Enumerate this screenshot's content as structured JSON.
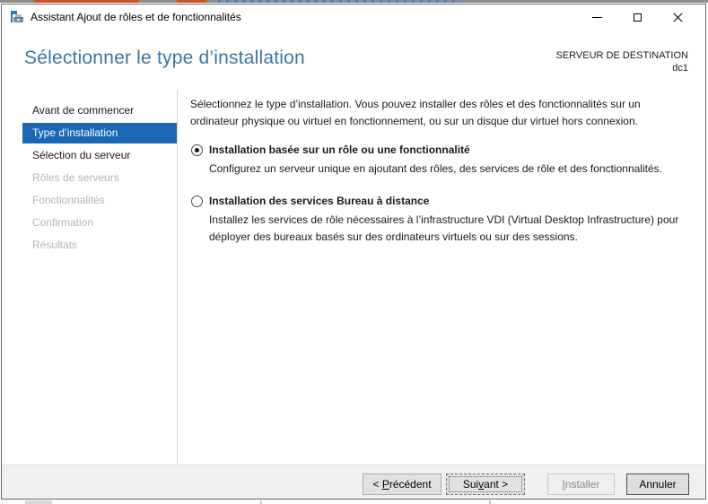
{
  "window": {
    "title": "Assistant Ajout de rôles et de fonctionnalités"
  },
  "header": {
    "page_title": "Sélectionner le type d’installation",
    "destination_label": "SERVEUR DE DESTINATION",
    "destination_server": "dc1"
  },
  "sidebar": {
    "items": [
      {
        "label": "Avant de commencer",
        "state": "enabled"
      },
      {
        "label": "Type d’installation",
        "state": "selected"
      },
      {
        "label": "Sélection du serveur",
        "state": "enabled"
      },
      {
        "label": "Rôles de serveurs",
        "state": "disabled"
      },
      {
        "label": "Fonctionnalités",
        "state": "disabled"
      },
      {
        "label": "Confirmation",
        "state": "disabled"
      },
      {
        "label": "Résultats",
        "state": "disabled"
      }
    ]
  },
  "content": {
    "intro": "Sélectionnez le type d’installation. Vous pouvez installer des rôles et des fonctionnalités sur un ordinateur physique ou virtuel en fonctionnement, ou sur un disque dur virtuel hors connexion.",
    "options": [
      {
        "selected": true,
        "label": "Installation basée sur un rôle ou une fonctionnalité",
        "description": "Configurez un serveur unique en ajoutant des rôles, des services de rôle et des fonctionnalités."
      },
      {
        "selected": false,
        "label": "Installation des services Bureau à distance",
        "description": "Installez les services de rôle nécessaires à l’infrastructure VDI (Virtual Desktop Infrastructure) pour déployer des bureaux basés sur des ordinateurs virtuels ou sur des sessions."
      }
    ]
  },
  "footer": {
    "buttons": {
      "previous": {
        "pre": "< ",
        "key": "P",
        "post": "récédent",
        "enabled": true
      },
      "next": {
        "pre": "Sui",
        "key": "v",
        "post": "ant >",
        "enabled": true,
        "focused": true
      },
      "install": {
        "pre": "",
        "key": "I",
        "post": "nstaller",
        "enabled": false
      },
      "cancel": {
        "pre": "",
        "key": "",
        "post": "Annuler",
        "enabled": true
      }
    }
  },
  "theme": {
    "nav_selected_bg": "#1a68b5",
    "nav_selected_text": "#ffffff",
    "heading_blue": "#3a76a4",
    "disabled_text": "#b4b4b4",
    "footer_bg": "#f0f0f0",
    "window_border": "#696969",
    "strip_orange": "#cc5220",
    "strip_blue": "#3584d6"
  }
}
